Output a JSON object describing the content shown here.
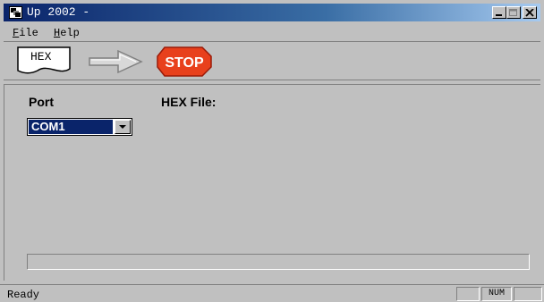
{
  "window": {
    "title": "Up 2002 -"
  },
  "menu": {
    "items": [
      {
        "label": "File"
      },
      {
        "label": "Help"
      }
    ]
  },
  "toolbar": {
    "hex_label": "HEX",
    "stop_label": "STOP"
  },
  "main": {
    "port_label": "Port",
    "hex_file_label": "HEX File:",
    "port_value": "COM1",
    "progress": 0
  },
  "status": {
    "text": "Ready",
    "num": "NUM"
  },
  "colors": {
    "titlebar": "#0a246a",
    "face": "#c0c0c0",
    "stop": "#e8401c",
    "selection": "#0a246a"
  },
  "icons": [
    "app-icon",
    "minimize-icon",
    "maximize-icon",
    "close-icon",
    "hex-file-icon",
    "arrow-icon",
    "stop-icon",
    "dropdown-arrow-icon"
  ]
}
